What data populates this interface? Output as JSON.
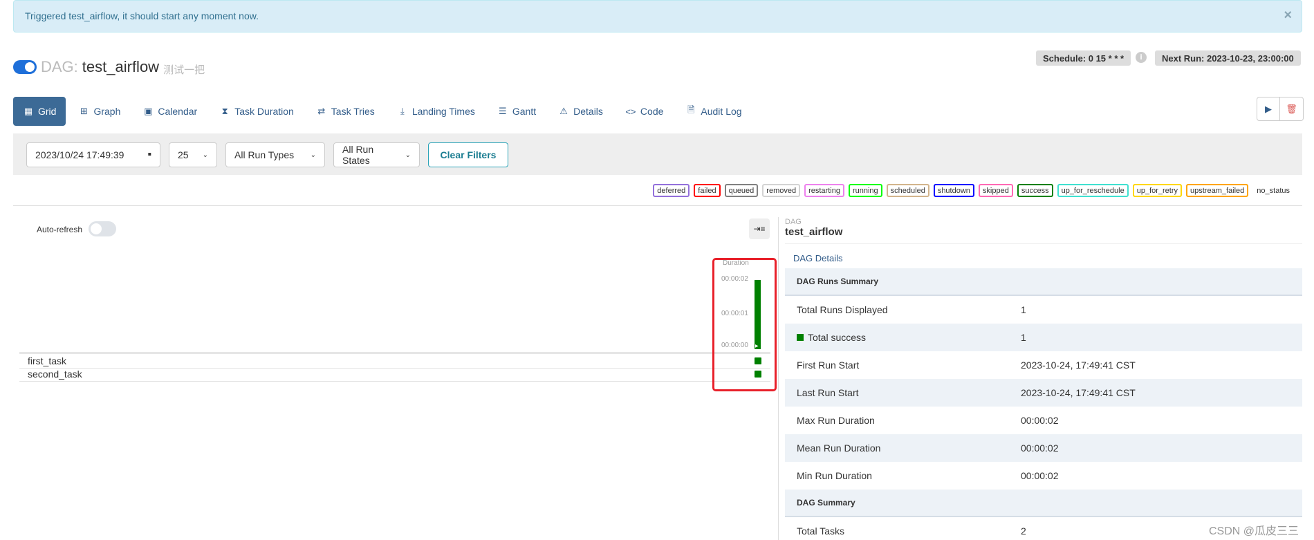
{
  "alert": {
    "message": "Triggered test_airflow, it should start any moment now.",
    "close_icon": "×"
  },
  "header": {
    "dag_prefix": "DAG:",
    "dag_id": "test_airflow",
    "description": "测试一把",
    "schedule": "Schedule: 0 15 * * *",
    "next_run": "Next Run: 2023-10-23, 23:00:00",
    "info_icon": "i"
  },
  "nav": {
    "items": [
      {
        "label": "Grid",
        "icon": "grid-icon",
        "glyph": "▦"
      },
      {
        "label": "Graph",
        "icon": "graph-icon",
        "glyph": "⊞"
      },
      {
        "label": "Calendar",
        "icon": "calendar-icon",
        "glyph": "▣"
      },
      {
        "label": "Task Duration",
        "icon": "hourglass-icon",
        "glyph": "⧗"
      },
      {
        "label": "Task Tries",
        "icon": "retry-icon",
        "glyph": "⇄"
      },
      {
        "label": "Landing Times",
        "icon": "plane-landing-icon",
        "glyph": "⤓"
      },
      {
        "label": "Gantt",
        "icon": "gantt-icon",
        "glyph": "☰"
      },
      {
        "label": "Details",
        "icon": "warning-triangle-icon",
        "glyph": "⚠"
      },
      {
        "label": "Code",
        "icon": "code-icon",
        "glyph": "<>"
      },
      {
        "label": "Audit Log",
        "icon": "audit-log-icon",
        "glyph": "🗎"
      }
    ],
    "play_glyph": "▶",
    "delete_glyph": "🗑"
  },
  "filters": {
    "datetime": "2023/10/24 17:49:39",
    "calendar_glyph": "▪",
    "num_runs": "25",
    "run_types": "All Run Types",
    "run_states": "All Run States",
    "chevron": "⌄",
    "clear": "Clear Filters"
  },
  "legend": {
    "items": [
      {
        "label": "deferred",
        "color": "#9370db"
      },
      {
        "label": "failed",
        "color": "#ff0000"
      },
      {
        "label": "queued",
        "color": "#808080"
      },
      {
        "label": "removed",
        "color": "#d3d3d3"
      },
      {
        "label": "restarting",
        "color": "#ee82ee"
      },
      {
        "label": "running",
        "color": "#00ff00"
      },
      {
        "label": "scheduled",
        "color": "#d2b48c"
      },
      {
        "label": "shutdown",
        "color": "#0000ff"
      },
      {
        "label": "skipped",
        "color": "#ff69b4"
      },
      {
        "label": "success",
        "color": "#008000"
      },
      {
        "label": "up_for_reschedule",
        "color": "#40e0d0"
      },
      {
        "label": "up_for_retry",
        "color": "#ffd700"
      },
      {
        "label": "upstream_failed",
        "color": "#ffa500"
      },
      {
        "label": "no_status",
        "color": ""
      }
    ]
  },
  "grid": {
    "auto_refresh": "Auto-refresh",
    "collapse_glyph": "⇥≡",
    "duration_title": "Duration",
    "ticks": [
      "00:00:02",
      "00:00:01",
      "00:00:00"
    ],
    "run_duration_seconds": 2,
    "run_state_color": "#008000",
    "tasks": [
      "first_task",
      "second_task"
    ]
  },
  "details": {
    "label": "DAG",
    "dag_id": "test_airflow",
    "link": "DAG Details",
    "runs_summary_title": "DAG Runs Summary",
    "runs_summary": [
      {
        "k": "Total Runs Displayed",
        "v": "1"
      },
      {
        "k": "Total success",
        "v": "1"
      },
      {
        "k": "First Run Start",
        "v": "2023-10-24, 17:49:41 CST"
      },
      {
        "k": "Last Run Start",
        "v": "2023-10-24, 17:49:41 CST"
      },
      {
        "k": "Max Run Duration",
        "v": "00:00:02"
      },
      {
        "k": "Mean Run Duration",
        "v": "00:00:02"
      },
      {
        "k": "Min Run Duration",
        "v": "00:00:02"
      }
    ],
    "dag_summary_title": "DAG Summary",
    "dag_summary": [
      {
        "k": "Total Tasks",
        "v": "2"
      }
    ]
  },
  "watermark": "CSDN @瓜皮三三"
}
